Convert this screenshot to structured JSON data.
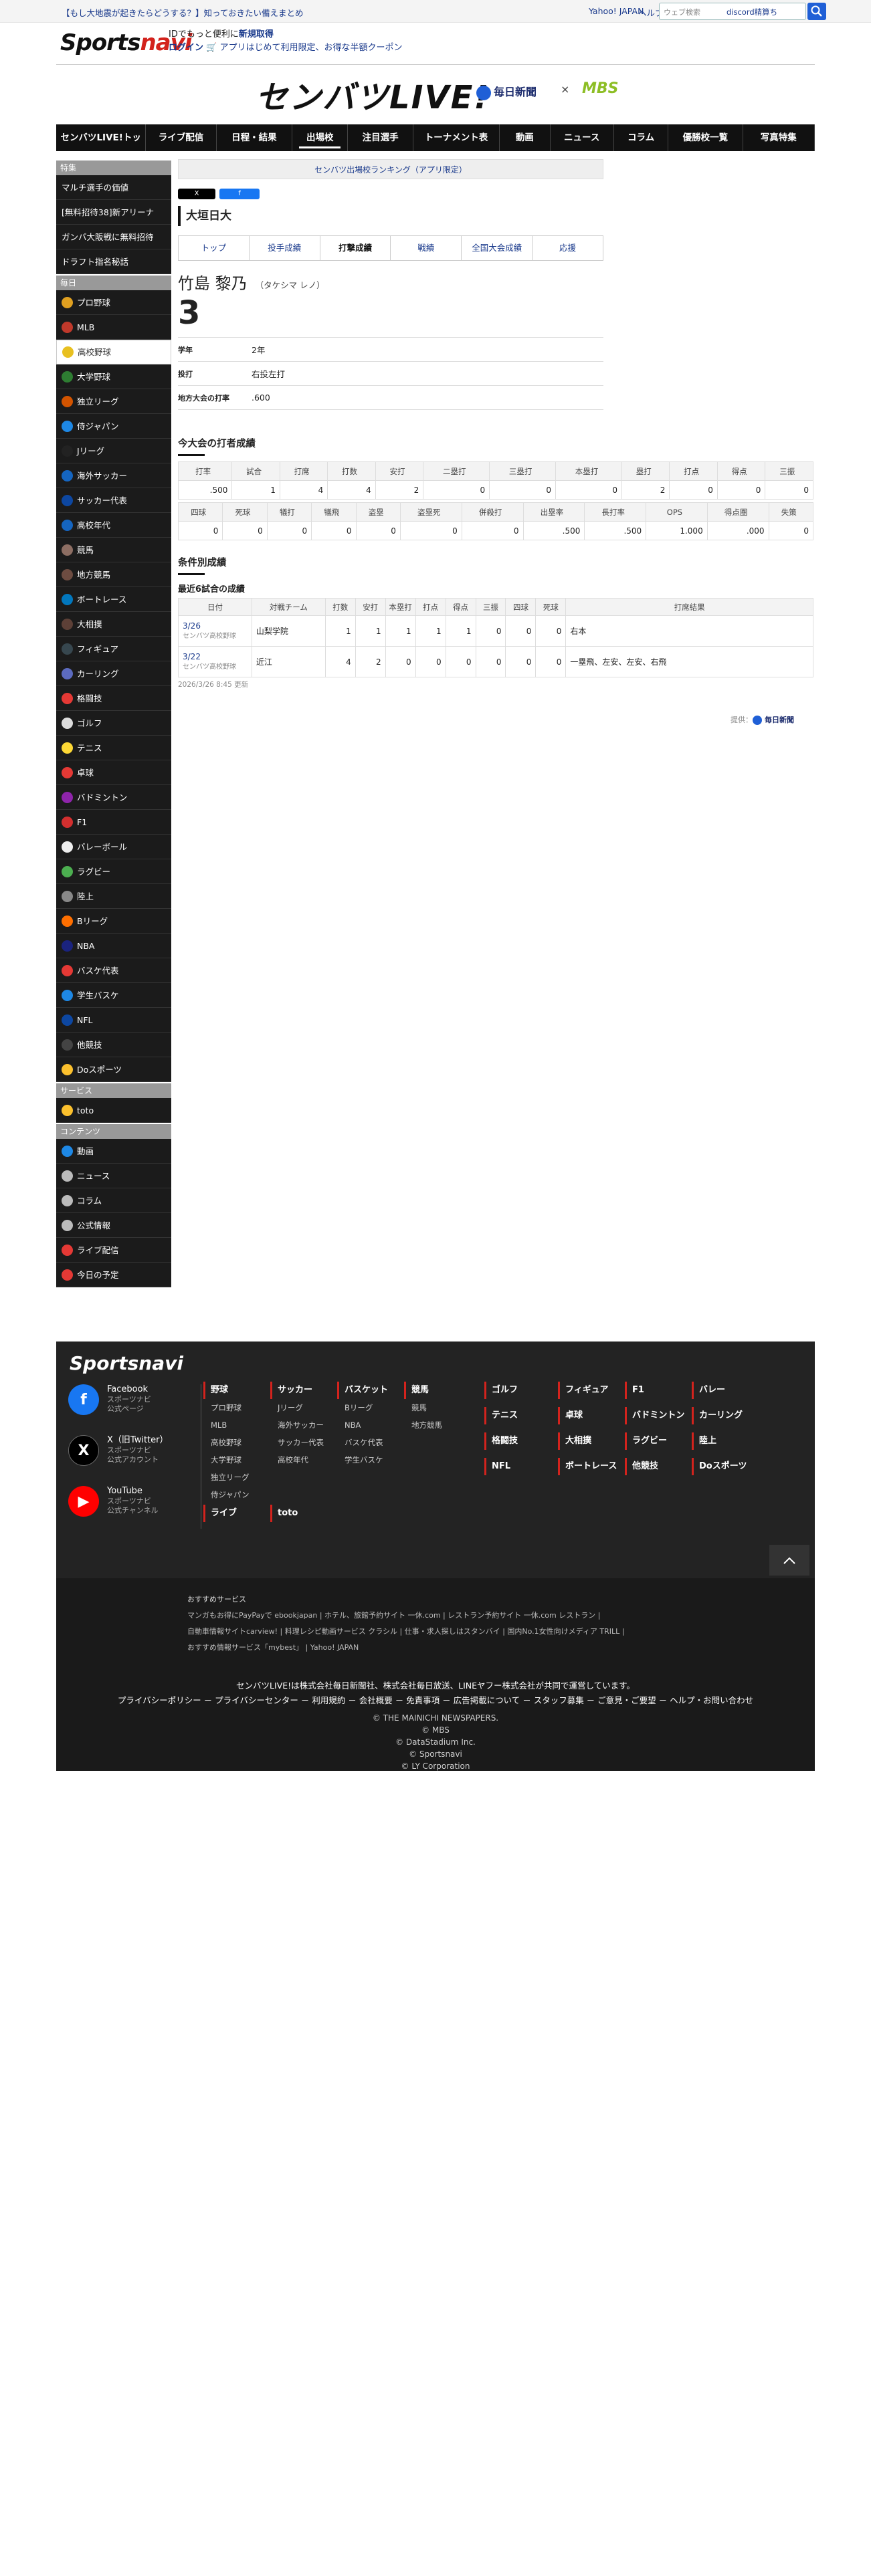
{
  "topbar": {
    "promo": "【もし大地震が起きたらどうする？】知っておきたい備えまとめ",
    "yahoo": "Yahoo! JAPAN",
    "help": "ヘルプ",
    "search_placeholder": "ウェブ検索",
    "search_suggest": "discord精算ち"
  },
  "header": {
    "logo_sports": "Sports",
    "logo_navi": "navi",
    "line1_a": "IDでもっと便利に",
    "line1_b": "新規取得",
    "line2_a": "ログイン",
    "line2_b": "アプリはじめて利用限定、お得な半額クーポン",
    "brand_title": "センバツLIVE!",
    "partner1": "毎日新聞",
    "times": "×",
    "partner2": "MBS"
  },
  "nav": [
    "センバツLIVE!トップ",
    "ライブ配信",
    "日程・結果",
    "出場校",
    "注目選手",
    "トーナメント表",
    "動画",
    "ニュース",
    "コラム",
    "優勝校一覧",
    "写真特集"
  ],
  "sidebar": {
    "feature_label": "特集",
    "feature": [
      "マルチ選手の価値",
      "[無料招待38]新アリーナ",
      "ガンバ大阪戦に無料招待",
      "ドラフト指名秘話"
    ],
    "daily_label": "毎日",
    "daily": [
      "プロ野球",
      "MLB",
      "高校野球",
      "大学野球",
      "独立リーグ",
      "侍ジャパン",
      "Jリーグ",
      "海外サッカー",
      "サッカー代表",
      "高校年代",
      "競馬",
      "地方競馬",
      "ボートレース",
      "大相撲",
      "フィギュア",
      "カーリング",
      "格闘技",
      "ゴルフ",
      "テニス",
      "卓球",
      "バドミントン",
      "F1",
      "バレーボール",
      "ラグビー",
      "陸上",
      "Bリーグ",
      "NBA",
      "バスケ代表",
      "学生バスケ",
      "NFL",
      "他競技",
      "Doスポーツ"
    ],
    "service_label": "サービス",
    "service": [
      "toto"
    ],
    "content_label": "コンテンツ",
    "content": [
      "動画",
      "ニュース",
      "コラム",
      "公式情報",
      "ライブ配信",
      "今日の予定"
    ]
  },
  "main": {
    "ranking_link": "センバツ出場校ランキング（アプリ限定）",
    "share_x": "X",
    "share_fb": "f",
    "school": "大垣日大",
    "tabs": [
      "トップ",
      "投手成績",
      "打撃成績",
      "戦績",
      "全国大会成績",
      "応援"
    ],
    "player_name": "竹島 黎乃",
    "player_kana": "（タケシマ レノ）",
    "player_number": "3",
    "info": [
      {
        "k": "学年",
        "v": "2年"
      },
      {
        "k": "投打",
        "v": "右投左打"
      },
      {
        "k": "地方大会の打率",
        "v": ".600"
      }
    ],
    "batting_title": "今大会の打者成績",
    "bat_h1": [
      "打率",
      "試合",
      "打席",
      "打数",
      "安打",
      "二塁打",
      "三塁打",
      "本塁打",
      "塁打",
      "打点",
      "得点",
      "三振"
    ],
    "bat_v1": [
      ".500",
      "1",
      "4",
      "4",
      "2",
      "0",
      "0",
      "0",
      "2",
      "0",
      "0",
      "0"
    ],
    "bat_h2": [
      "四球",
      "死球",
      "犠打",
      "犠飛",
      "盗塁",
      "盗塁死",
      "併殺打",
      "出塁率",
      "長打率",
      "OPS",
      "得点圏",
      "失策"
    ],
    "bat_v2": [
      "0",
      "0",
      "0",
      "0",
      "0",
      "0",
      "0",
      ".500",
      ".500",
      "1.000",
      ".000",
      "0"
    ],
    "cond_title": "条件別成績",
    "recent_title": "最近6試合の成績",
    "game_h": [
      "日付",
      "対戦チーム",
      "打数",
      "安打",
      "本塁打",
      "打点",
      "得点",
      "三振",
      "四球",
      "死球",
      "打席結果"
    ],
    "games": [
      {
        "date": "3/26",
        "tourn": "センバツ高校野球",
        "opp": "山梨学院",
        "vals": [
          "1",
          "1",
          "1",
          "1",
          "1",
          "0",
          "0",
          "0"
        ],
        "result": "右本"
      },
      {
        "date": "3/22",
        "tourn": "センバツ高校野球",
        "opp": "近江",
        "vals": [
          "4",
          "2",
          "0",
          "0",
          "0",
          "0",
          "0",
          "0"
        ],
        "result": "一塁飛、左安、左安、右飛"
      }
    ],
    "updated": "2026/3/26 8:45 更新",
    "provided_label": "提供：",
    "provided": "毎日新聞"
  },
  "footer": {
    "logo": "Sportsnavi",
    "social": [
      {
        "name": "Facebook",
        "sub1": "スポーツナビ",
        "sub2": "公式ページ",
        "icon": "facebook-icon",
        "color": "#1877f2",
        "glyph": "f"
      },
      {
        "name": "X（旧Twitter）",
        "sub1": "スポーツナビ",
        "sub2": "公式アカウント",
        "icon": "x-icon",
        "color": "#000000",
        "glyph": "X"
      },
      {
        "name": "YouTube",
        "sub1": "スポーツナビ",
        "sub2": "公式チャンネル",
        "icon": "youtube-icon",
        "color": "#ff0000",
        "glyph": "▶"
      }
    ],
    "cols": [
      {
        "h": "野球",
        "sub": [
          "プロ野球",
          "MLB",
          "高校野球",
          "大学野球",
          "独立リーグ",
          "侍ジャパン"
        ]
      },
      {
        "h": "サッカー",
        "sub": [
          "Jリーグ",
          "海外サッカー",
          "サッカー代表",
          "高校年代"
        ]
      },
      {
        "h": "バスケット",
        "sub": [
          "Bリーグ",
          "NBA",
          "バスケ代表",
          "学生バスケ"
        ]
      },
      {
        "h": "競馬",
        "sub": [
          "競馬",
          "地方競馬"
        ]
      },
      {
        "h": "ゴルフ",
        "sub": []
      },
      {
        "h": "フィギュア",
        "sub": []
      },
      {
        "h": "F1",
        "sub": []
      },
      {
        "h": "バレー",
        "sub": []
      },
      {
        "h": "テニス",
        "sub": []
      },
      {
        "h": "卓球",
        "sub": []
      },
      {
        "h": "バドミントン",
        "sub": []
      },
      {
        "h": "カーリング",
        "sub": []
      },
      {
        "h": "格闘技",
        "sub": []
      },
      {
        "h": "大相撲",
        "sub": []
      },
      {
        "h": "ラグビー",
        "sub": []
      },
      {
        "h": "陸上",
        "sub": []
      },
      {
        "h": "NFL",
        "sub": []
      },
      {
        "h": "ボートレース",
        "sub": []
      },
      {
        "h": "他競技",
        "sub": []
      },
      {
        "h": "Doスポーツ",
        "sub": []
      }
    ],
    "live": "ライブ",
    "toto": "toto",
    "services_title": "おすすめサービス",
    "services1": "マンガもお得にPayPayで ebookjapan | ホテル、旅館予約サイト 一休.com | レストラン予約サイト 一休.com レストラン |",
    "services2": "自動車情報サイトcarview! | 料理レシピ動画サービス クラシル | 仕事・求人探しはスタンバイ | 国内No.1女性向けメディア TRILL |",
    "services3": "おすすめ情報サービス「mybest」 | Yahoo! JAPAN",
    "legal1": "センバツLIVE!は株式会社毎日新聞社、株式会社毎日放送、LINEヤフー株式会社が共同で運営しています。",
    "legal2": "プライバシーポリシー － プライバシーセンター － 利用規約 － 会社概要 － 免責事項 － 広告掲載について － スタッフ募集 － ご意見・ご要望 － ヘルプ・お問い合わせ",
    "copyright": [
      "© THE MAINICHI NEWSPAPERS.",
      "© MBS",
      "© DataStadium Inc.",
      "© Sportsnavi",
      "© LY Corporation"
    ]
  }
}
